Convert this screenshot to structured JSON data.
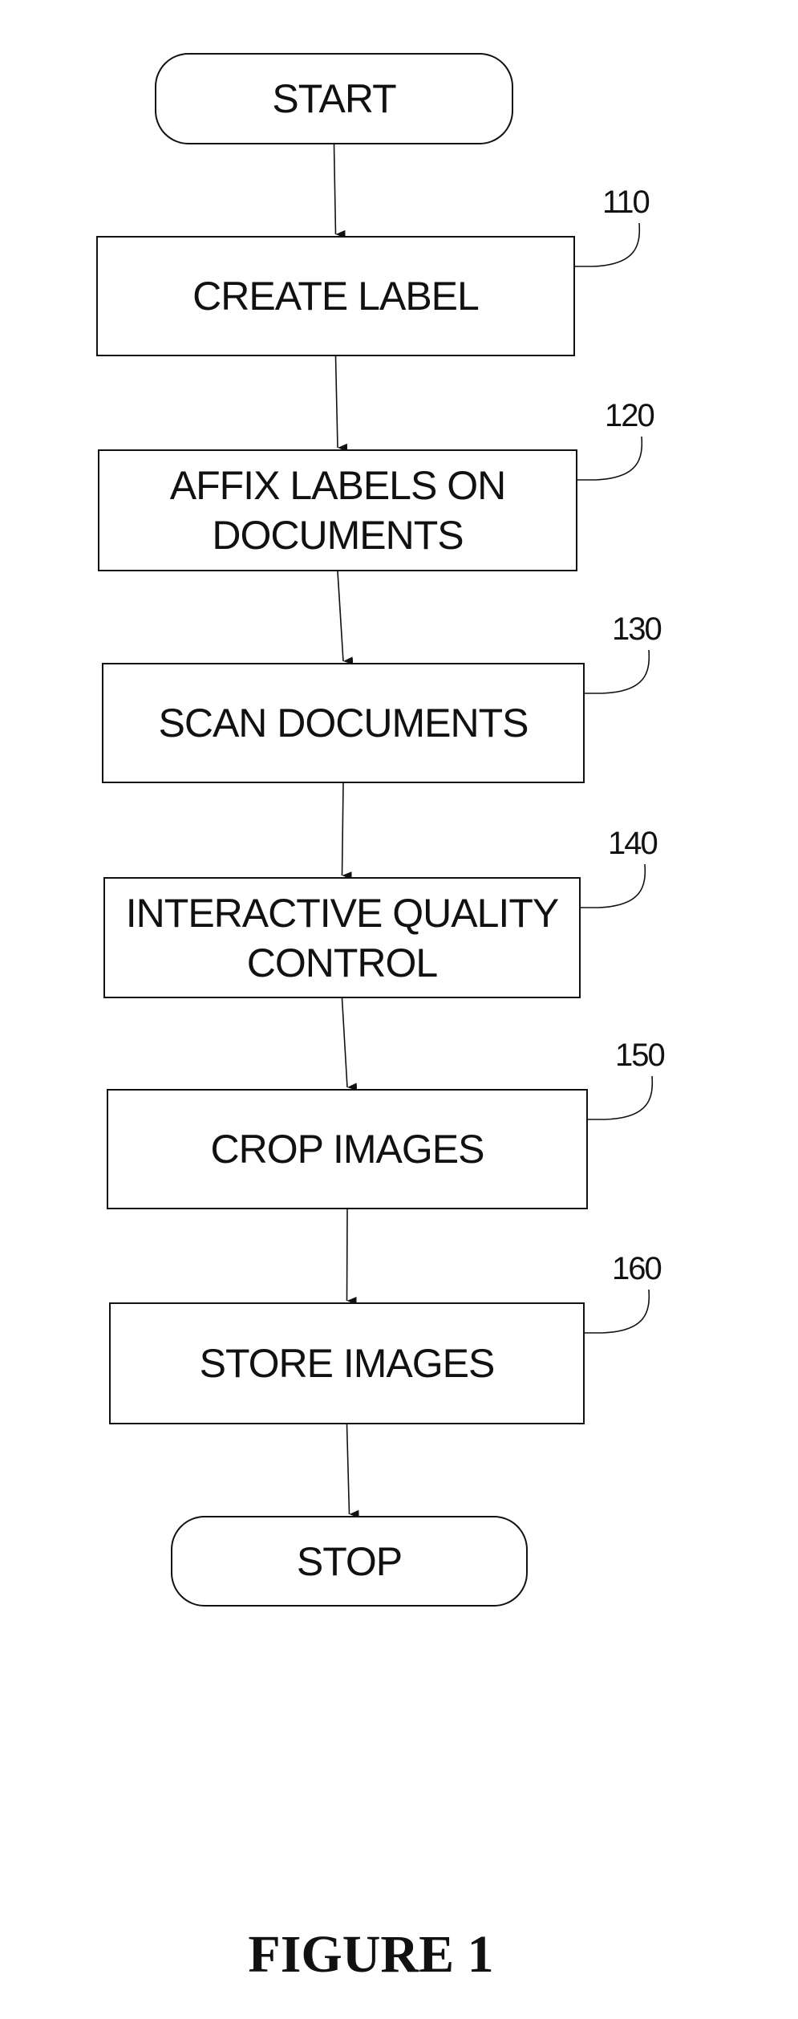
{
  "diagram": {
    "type": "flowchart",
    "nodes": [
      {
        "id": "start",
        "kind": "terminal",
        "label": "START"
      },
      {
        "id": "110",
        "kind": "process",
        "label": "CREATE LABEL",
        "ref": "110"
      },
      {
        "id": "120",
        "kind": "process",
        "label": "AFFIX LABELS ON\nDOCUMENTS",
        "ref": "120"
      },
      {
        "id": "130",
        "kind": "process",
        "label": "SCAN DOCUMENTS",
        "ref": "130"
      },
      {
        "id": "140",
        "kind": "process",
        "label": "INTERACTIVE QUALITY\nCONTROL",
        "ref": "140"
      },
      {
        "id": "150",
        "kind": "process",
        "label": "CROP IMAGES",
        "ref": "150"
      },
      {
        "id": "160",
        "kind": "process",
        "label": "STORE IMAGES",
        "ref": "160"
      },
      {
        "id": "stop",
        "kind": "terminal",
        "label": "STOP"
      }
    ],
    "edges": [
      {
        "from": "start",
        "to": "110"
      },
      {
        "from": "110",
        "to": "120"
      },
      {
        "from": "120",
        "to": "130"
      },
      {
        "from": "130",
        "to": "140"
      },
      {
        "from": "140",
        "to": "150"
      },
      {
        "from": "150",
        "to": "160"
      },
      {
        "from": "160",
        "to": "stop"
      }
    ]
  },
  "caption": "FIGURE 1",
  "colors": {
    "ink": "#111111",
    "paper": "#ffffff"
  }
}
